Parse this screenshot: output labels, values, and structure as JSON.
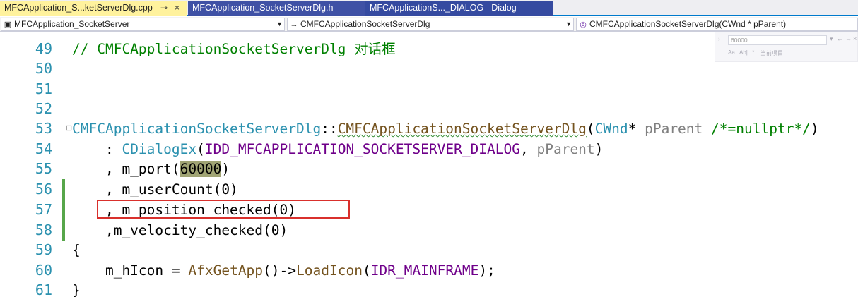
{
  "tabs": [
    {
      "label": "MFCApplication_S...ketServerDlg.cpp",
      "active": true,
      "pin": "⊸",
      "close": "×"
    },
    {
      "label": "MFCApplication_SocketServerDlg.h",
      "active": false
    },
    {
      "label": "MFCApplicationS..._DIALOG - Dialog",
      "active": false
    }
  ],
  "navbar": {
    "project": "MFCApplication_SocketServer",
    "class_scope": "CMFCApplicationSocketServerDlg",
    "member": "CMFCApplicationSocketServerDlg(CWnd * pParent)"
  },
  "find": {
    "value": "60000",
    "options": [
      "Aa",
      "Ab|",
      ".*",
      "当前项目"
    ]
  },
  "editor": {
    "lines": [
      {
        "num": "49"
      },
      {
        "num": "50"
      },
      {
        "num": "51"
      },
      {
        "num": "52"
      },
      {
        "num": "53"
      },
      {
        "num": "54"
      },
      {
        "num": "55"
      },
      {
        "num": "56"
      },
      {
        "num": "57"
      },
      {
        "num": "58"
      },
      {
        "num": "59"
      },
      {
        "num": "60"
      },
      {
        "num": "61"
      }
    ],
    "code": {
      "l49_comment": "// CMFCApplicationSocketServerDlg 对话框",
      "l53_class": "CMFCApplicationSocketServerDlg",
      "l53_scope": "::",
      "l53_ctor": "CMFCApplicationSocketServerDlg",
      "l53_paren": "(",
      "l53_type": "CWnd",
      "l53_star": "* ",
      "l53_param": "pParent",
      "l53_default": " /*=nullptr*/",
      "l53_close": ")",
      "l54_prefix": "    : ",
      "l54_base": "CDialogEx",
      "l54_paren": "(",
      "l54_macro": "IDD_MFCAPPLICATION_SOCKETSERVER_DIALOG",
      "l54_comma": ", ",
      "l54_param": "pParent",
      "l54_close": ")",
      "l55_prefix": "    , m_port(",
      "l55_value": "60000",
      "l55_close": ")",
      "l56": "    , m_userCount(0)",
      "l57": "    , m_position_checked(0)",
      "l58": "    ,m_velocity_checked(0)",
      "l59": "{",
      "l60_prefix": "    m_hIcon = ",
      "l60_fn1": "AfxGetApp",
      "l60_mid": "()->",
      "l60_fn2": "LoadIcon",
      "l60_paren": "(",
      "l60_macro": "IDR_MAINFRAME",
      "l60_close": ");",
      "l61": "}"
    },
    "highlighted_line": "57",
    "colors": {
      "comment": "#008000",
      "type": "#2b91af",
      "function": "#74531f",
      "macro": "#6f008a",
      "parameter": "#808080",
      "highlight_box": "#d9302c",
      "change_bar": "#57a64a"
    }
  }
}
